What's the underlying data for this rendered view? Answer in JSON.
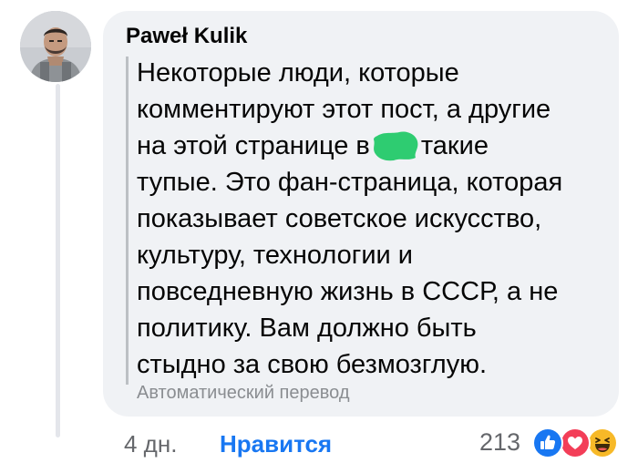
{
  "comment": {
    "author": "Paweł Kulik",
    "lines": [
      "Некоторые люди, которые",
      "комментируют этот пост, а другие",
      "на этой странице в",
      "такие",
      "тупые. Это фан-страница, которая",
      "показывает советское искусство,",
      "культуру, технологии и",
      "повседневную жизнь в СССР, а не",
      "политику. Вам должно быть",
      "стыдно за свою безмозглую."
    ],
    "translation_label": "Автоматический перевод",
    "redaction_color": "#2ecc71"
  },
  "actions": {
    "time": "4 дн.",
    "like_label": "Нравится"
  },
  "reactions": {
    "count": "213",
    "icons": [
      "like-icon",
      "love-icon",
      "haha-icon"
    ],
    "colors": {
      "like": "#1877f2",
      "love": "#f33e58",
      "haha": "#f7b928"
    }
  }
}
